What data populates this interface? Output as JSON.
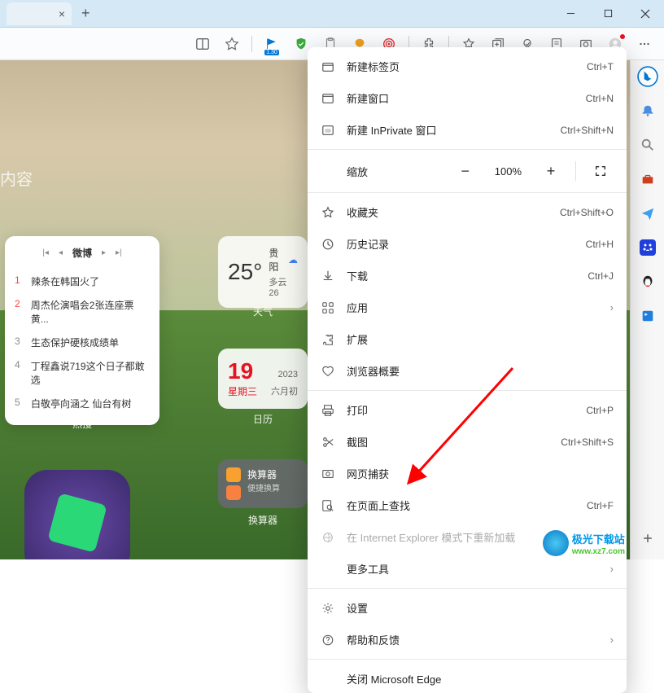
{
  "titlebar": {
    "new_tab_plus": "+"
  },
  "toolbar": {
    "badge": "1.30"
  },
  "content": {
    "search_placeholder": "内容",
    "weibo": {
      "title": "微博",
      "items": [
        {
          "n": "1",
          "text": "辣条在韩国火了",
          "hot": true
        },
        {
          "n": "2",
          "text": "周杰伦演唱会2张连座票黄...",
          "hot": true
        },
        {
          "n": "3",
          "text": "生态保护硬核成绩单",
          "hot": false
        },
        {
          "n": "4",
          "text": "丁程鑫说719这个日子都敢选",
          "hot": false
        },
        {
          "n": "5",
          "text": "白敬亭向涵之 仙台有树",
          "hot": false
        }
      ],
      "label": "热搜"
    },
    "weather": {
      "temp": "25°",
      "location": "贵阳",
      "desc": "多云 26",
      "label": "天气"
    },
    "date": {
      "day": "19",
      "year": "2023",
      "week": "星期三",
      "lunar": "六月初",
      "label": "日历"
    },
    "converter": {
      "title": "换算器",
      "sub": "便捷换算",
      "label": "换算器"
    }
  },
  "menu": {
    "new_tab": "新建标签页",
    "new_tab_key": "Ctrl+T",
    "new_window": "新建窗口",
    "new_window_key": "Ctrl+N",
    "new_inprivate": "新建 InPrivate 窗口",
    "new_inprivate_key": "Ctrl+Shift+N",
    "zoom": "缩放",
    "zoom_val": "100%",
    "favorites": "收藏夹",
    "favorites_key": "Ctrl+Shift+O",
    "history": "历史记录",
    "history_key": "Ctrl+H",
    "downloads": "下载",
    "downloads_key": "Ctrl+J",
    "apps": "应用",
    "extensions": "扩展",
    "browser_essentials": "浏览器概要",
    "print": "打印",
    "print_key": "Ctrl+P",
    "screenshot": "截图",
    "screenshot_key": "Ctrl+Shift+S",
    "web_capture": "网页捕获",
    "find": "在页面上查找",
    "find_key": "Ctrl+F",
    "ie_mode": "在 Internet Explorer 模式下重新加载",
    "more_tools": "更多工具",
    "settings": "设置",
    "help": "帮助和反馈",
    "close_edge": "关闭 Microsoft Edge"
  },
  "watermark": {
    "name": "极光下载站",
    "url": "www.xz7.com"
  }
}
